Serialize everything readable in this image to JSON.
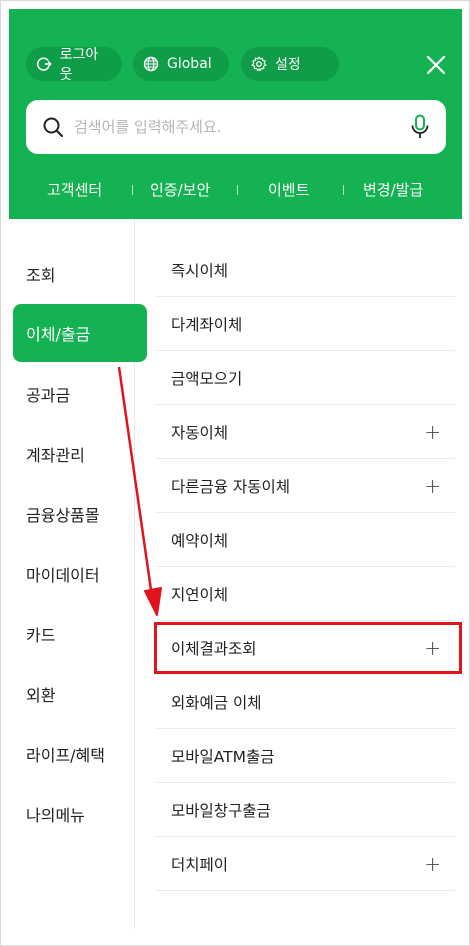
{
  "header": {
    "logout_label": "로그아웃",
    "global_label": "Global",
    "settings_label": "설정",
    "search_placeholder": "검색어를 입력해주세요.",
    "quick_links": [
      "고객센터",
      "인증/보안",
      "이벤트",
      "변경/발급"
    ]
  },
  "categories": [
    "조회",
    "이체/출금",
    "공과금",
    "계좌관리",
    "금융상품몰",
    "마이데이터",
    "카드",
    "외환",
    "라이프/혜택",
    "나의메뉴"
  ],
  "active_category_index": 1,
  "submenu": [
    {
      "label": "즉시이체",
      "expandable": false
    },
    {
      "label": "다계좌이체",
      "expandable": false
    },
    {
      "label": "금액모으기",
      "expandable": false
    },
    {
      "label": "자동이체",
      "expandable": true
    },
    {
      "label": "다른금융 자동이체",
      "expandable": true
    },
    {
      "label": "예약이체",
      "expandable": false
    },
    {
      "label": "지연이체",
      "expandable": false
    },
    {
      "label": "이체결과조회",
      "expandable": true
    },
    {
      "label": "외화예금 이체",
      "expandable": false
    },
    {
      "label": "모바일ATM출금",
      "expandable": false
    },
    {
      "label": "모바일창구출금",
      "expandable": false
    },
    {
      "label": "더치페이",
      "expandable": true
    }
  ],
  "plus_symbol": "+",
  "colors": {
    "brand_green": "#14b253",
    "pill_green": "#0f9e47",
    "annotation_red": "#e0141c"
  }
}
